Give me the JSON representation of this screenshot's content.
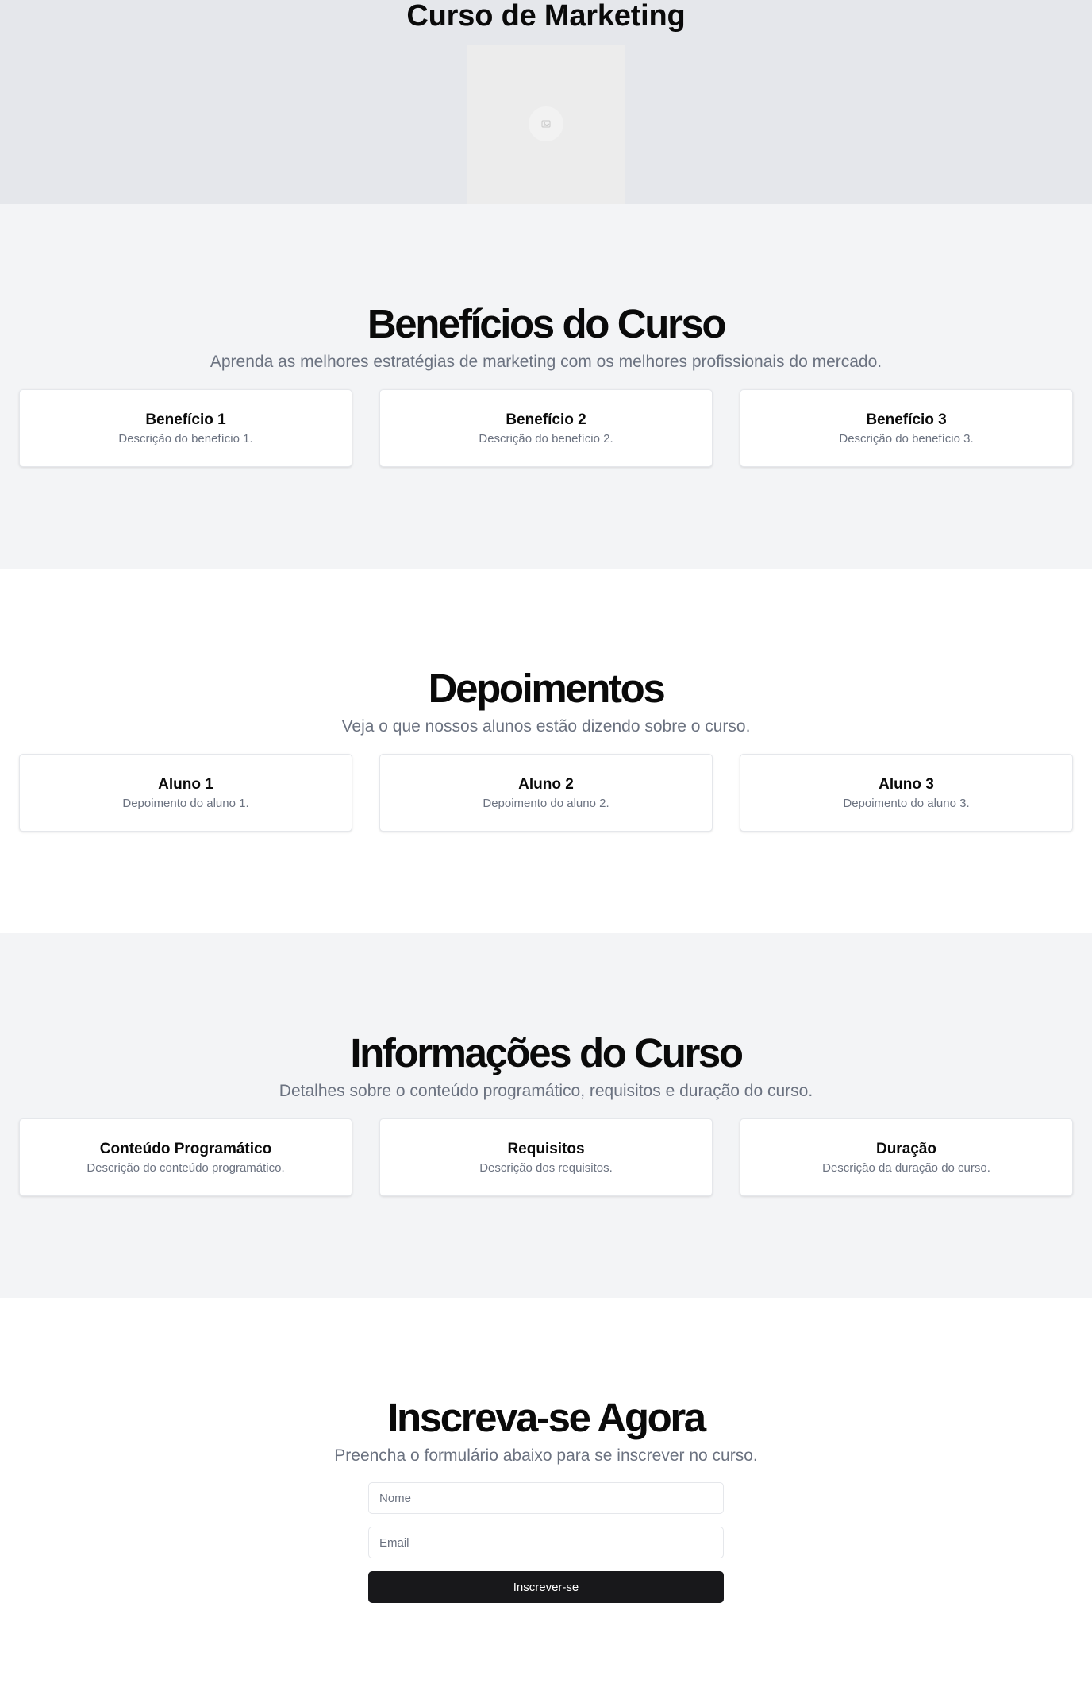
{
  "hero": {
    "title": "Curso de Marketing",
    "image_icon": "image-placeholder-icon"
  },
  "benefits": {
    "title": "Benefícios do Curso",
    "subtitle": "Aprenda as melhores estratégias de marketing com os melhores profissionais do mercado.",
    "cards": [
      {
        "title": "Benefício 1",
        "text": "Descrição do benefício 1."
      },
      {
        "title": "Benefício 2",
        "text": "Descrição do benefício 2."
      },
      {
        "title": "Benefício 3",
        "text": "Descrição do benefício 3."
      }
    ]
  },
  "testimonials": {
    "title": "Depoimentos",
    "subtitle": "Veja o que nossos alunos estão dizendo sobre o curso.",
    "cards": [
      {
        "title": "Aluno 1",
        "text": "Depoimento do aluno 1."
      },
      {
        "title": "Aluno 2",
        "text": "Depoimento do aluno 2."
      },
      {
        "title": "Aluno 3",
        "text": "Depoimento do aluno 3."
      }
    ]
  },
  "course_info": {
    "title": "Informações do Curso",
    "subtitle": "Detalhes sobre o conteúdo programático, requisitos e duração do curso.",
    "cards": [
      {
        "title": "Conteúdo Programático",
        "text": "Descrição do conteúdo programático."
      },
      {
        "title": "Requisitos",
        "text": "Descrição dos requisitos."
      },
      {
        "title": "Duração",
        "text": "Descrição da duração do curso."
      }
    ]
  },
  "signup": {
    "title": "Inscreva-se Agora",
    "subtitle": "Preencha o formulário abaixo para se inscrever no curso.",
    "name_placeholder": "Nome",
    "name_value": "",
    "email_placeholder": "Email",
    "email_value": "",
    "submit_label": "Inscrever-se"
  },
  "colors": {
    "hero_bg": "#e5e7eb",
    "section_gray_bg": "#f3f4f6",
    "muted_text": "#6b7280",
    "primary_button": "#18181b"
  }
}
